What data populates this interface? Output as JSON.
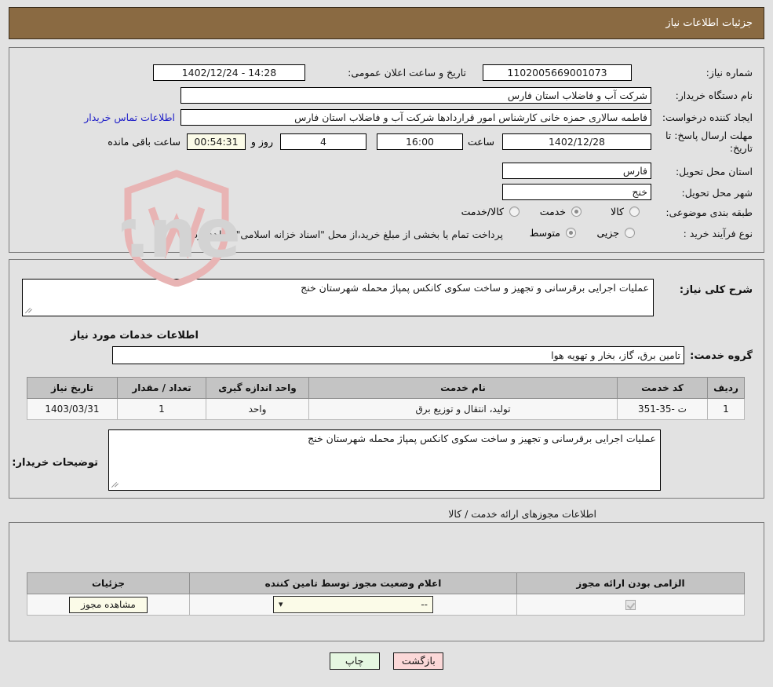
{
  "header": {
    "title": "جزئیات اطلاعات نیاز"
  },
  "watermark": {
    "text": "AriaTender.net"
  },
  "form": {
    "need_number_label": "شماره نیاز:",
    "need_number_value": "1102005669001073",
    "announce_datetime_label": "تاریخ و ساعت اعلان عمومی:",
    "announce_datetime_value": "14:28 - 1402/12/24",
    "buyer_org_label": "نام دستگاه خریدار:",
    "buyer_org_value": "شرکت آب و فاضلاب استان فارس",
    "requester_label": "ایجاد کننده درخواست:",
    "requester_value": "فاطمه سالاری حمزه خانی کارشناس امور قراردادها شرکت آب و فاضلاب استان فارس",
    "buyer_contact_link": "اطلاعات تماس خریدار",
    "deadline_label": "مهلت ارسال پاسخ: تا تاریخ:",
    "deadline_date_value": "1402/12/28",
    "hour_label": "ساعت",
    "deadline_time_value": "16:00",
    "days_remaining_value": "4",
    "days_and_label": "روز و",
    "countdown_value": "00:54:31",
    "hours_remaining_label": "ساعت باقی مانده",
    "delivery_province_label": "استان محل تحویل:",
    "delivery_province_value": "فارس",
    "delivery_city_label": "شهر محل تحویل:",
    "delivery_city_value": "خنج",
    "category_label": "طبقه بندی موضوعی:",
    "category_options": [
      {
        "label": "کالا",
        "selected": false
      },
      {
        "label": "خدمت",
        "selected": true
      },
      {
        "label": "کالا/خدمت",
        "selected": false
      }
    ],
    "process_type_label": "نوع فرآیند خرید :",
    "process_type_options": [
      {
        "label": "جزیی",
        "selected": false
      },
      {
        "label": "متوسط",
        "selected": true
      }
    ],
    "payment_note": "پرداخت تمام یا بخشی از مبلغ خرید،از محل \"اسناد خزانه اسلامی\" خواهد بود."
  },
  "middle": {
    "general_desc_label": "شرح کلی نیاز:",
    "general_desc_value": "عملیات اجرایی برقرسانی و تجهیز و ساخت سکوی کانکس پمپاژ محمله شهرستان خنج",
    "services_info_title": "اطلاعات خدمات مورد نیاز",
    "service_group_label": "گروه خدمت:",
    "service_group_value": "تامین برق، گاز، بخار و تهویه هوا",
    "table": {
      "headers": [
        "ردیف",
        "کد خدمت",
        "نام خدمت",
        "واحد اندازه گیری",
        "تعداد / مقدار",
        "تاریخ نیاز"
      ],
      "rows": [
        {
          "row_no": "1",
          "service_code": "ت -35-351",
          "service_name": "تولید، انتقال و توزیع برق",
          "unit": "واحد",
          "quantity": "1",
          "need_date": "1403/03/31"
        }
      ]
    },
    "buyer_notes_label": "توضیحات خریدار:",
    "buyer_notes_value": "عملیات اجرایی برقرسانی و تجهیز و ساخت سکوی کانکس پمپاژ محمله شهرستان خنج"
  },
  "permits": {
    "section_caption": "اطلاعات مجوزهای ارائه خدمت / کالا",
    "headers": [
      "الزامی بودن ارائه مجوز",
      "اعلام وضعیت مجوز توسط تامین کننده",
      "جزئیات"
    ],
    "rows": [
      {
        "required_checked": true,
        "status_selected": "--",
        "details_button": "مشاهده مجوز"
      }
    ]
  },
  "footer": {
    "print_label": "چاپ",
    "back_label": "بازگشت"
  }
}
